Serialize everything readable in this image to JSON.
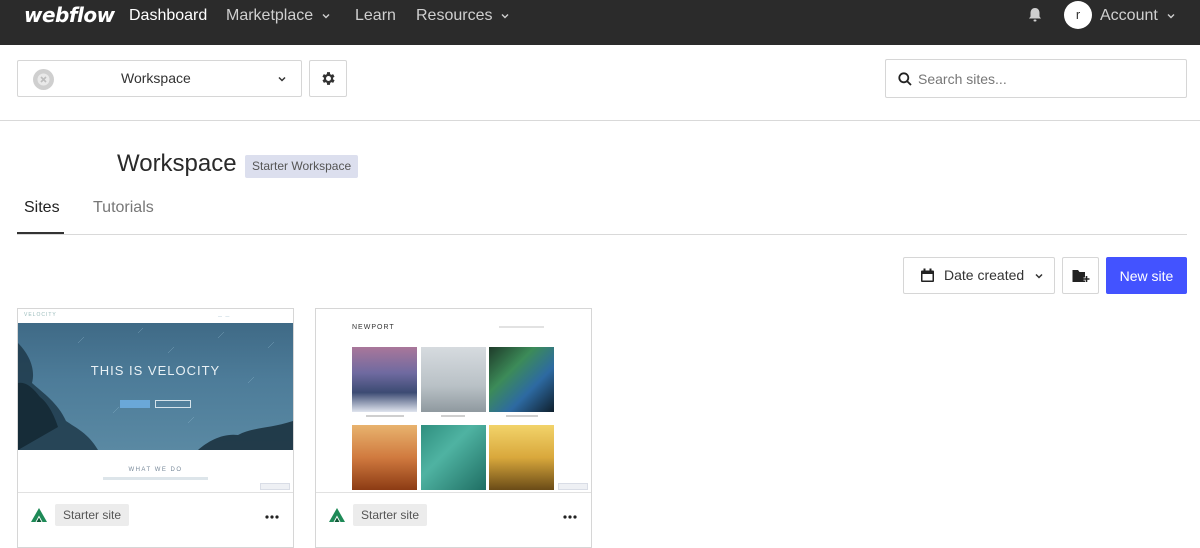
{
  "nav": {
    "logo": "webflow",
    "items": [
      {
        "label": "Dashboard",
        "active": true,
        "dropdown": false
      },
      {
        "label": "Marketplace",
        "active": false,
        "dropdown": true
      },
      {
        "label": "Learn",
        "active": false,
        "dropdown": false
      },
      {
        "label": "Resources",
        "active": false,
        "dropdown": true
      }
    ],
    "notifications_icon": "bell-icon",
    "avatar_initial": "r",
    "account_label": "Account"
  },
  "toolbar": {
    "workspace_select": "Workspace",
    "settings_icon": "gear-icon",
    "search_placeholder": "Search sites..."
  },
  "workspace": {
    "title": "Workspace",
    "plan_badge": "Starter Workspace"
  },
  "tabs": [
    {
      "label": "Sites",
      "active": true
    },
    {
      "label": "Tutorials",
      "active": false
    }
  ],
  "actions": {
    "sort_label": "Date created",
    "new_folder_icon": "folder-plus-icon",
    "new_site_label": "New site"
  },
  "sites": [
    {
      "badge": "Starter site",
      "preview": {
        "brand": "VELOCITY",
        "headline": "THIS IS VELOCITY",
        "section": "WHAT WE DO"
      }
    },
    {
      "badge": "Starter site",
      "preview": {
        "brand": "NEWPORT"
      }
    }
  ],
  "colors": {
    "nav_bg": "#2b2b2b",
    "primary": "#4353ff",
    "badge_bg": "#dcdfee",
    "site_logo": "#1e8a57"
  }
}
